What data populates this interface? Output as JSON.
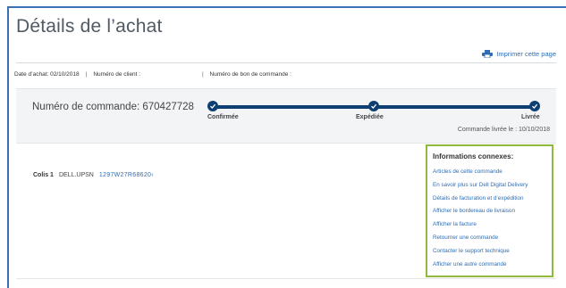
{
  "page": {
    "title": "Détails de l’achat"
  },
  "toolbar": {
    "print_label": "Imprimer cette page"
  },
  "meta": {
    "purchase_date": "Date d’achat: 02/10/2018",
    "client_number": "Numéro de client :",
    "po_number": "Numéro de bon de commande :",
    "separator": "|"
  },
  "order": {
    "number_label": "Numéro de commande: 670427728",
    "steps": [
      {
        "label": "Confirmée"
      },
      {
        "label": "Expédiée"
      },
      {
        "label": "Livrée"
      }
    ],
    "delivered_text": "Commande livrée le : 10/10/2018",
    "progress_fraction": 1.0
  },
  "package": {
    "label": "Colis 1",
    "carrier": "DELL.UPSN",
    "tracking": "1297W27R68620‹"
  },
  "related": {
    "title": "Informations connexes:",
    "links": [
      "Articles de cette commande",
      "En savoir plus sur Dell Digital Delivery",
      "Détails de facturation et d’expédition",
      "Afficher le bordereau de livraison",
      "Afficher la facture",
      "Retourner une commande",
      "Contacter le support technique",
      "Afficher une autre commande"
    ]
  },
  "colors": {
    "accent": "#2e6db4",
    "tracker": "#0e3f73",
    "highlight_border": "#8fba3e",
    "frame": "#3b6fb6"
  },
  "icons": {
    "print": "printer-icon",
    "step": "check-icon"
  }
}
